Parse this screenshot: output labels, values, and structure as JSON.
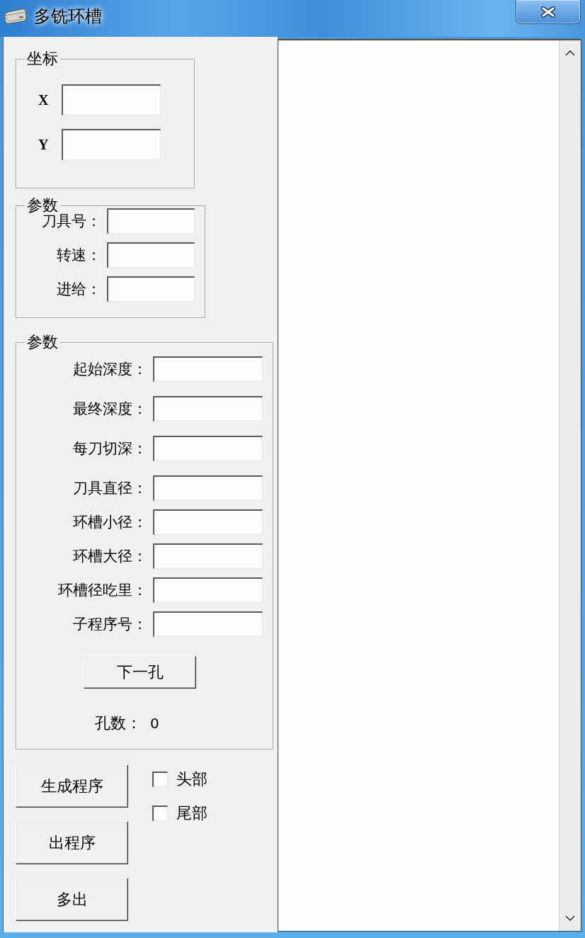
{
  "window": {
    "title": "多铣环槽"
  },
  "coordinates": {
    "legend": "坐标",
    "fields": [
      {
        "label": "X"
      },
      {
        "label": "Y"
      }
    ]
  },
  "tool": {
    "legend": "参数",
    "fields": [
      {
        "label": "刀具号："
      },
      {
        "label": "转速："
      },
      {
        "label": "进给："
      }
    ]
  },
  "groove": {
    "legend": "参数",
    "fields": [
      {
        "label": "起始深度："
      },
      {
        "label": "最终深度："
      },
      {
        "label": "每刀切深："
      },
      {
        "label": "刀具直径："
      },
      {
        "label": "环槽小径："
      },
      {
        "label": "环槽大径："
      },
      {
        "label": "环槽径吃里："
      },
      {
        "label": "子程序号："
      }
    ],
    "next_button": "下一孔",
    "hole_count_label": "孔数：",
    "hole_count": "0"
  },
  "buttons": [
    "生成程序",
    "出程序",
    "多出"
  ],
  "options": [
    {
      "label": "头部",
      "checked": false
    },
    {
      "label": "尾部",
      "checked": false
    }
  ]
}
